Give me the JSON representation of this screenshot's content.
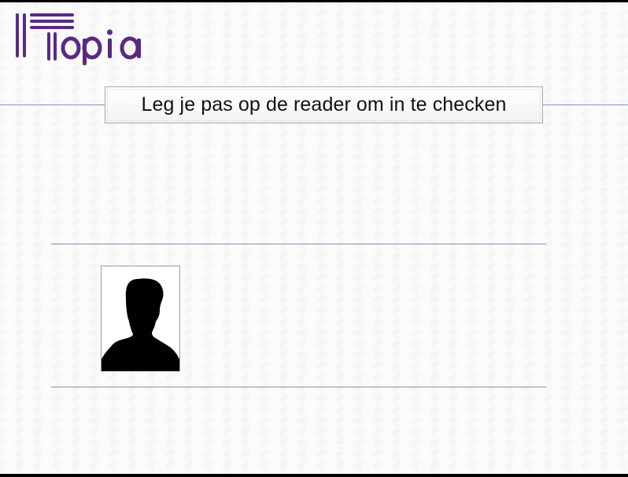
{
  "app": {
    "brand": "Topia"
  },
  "checkin": {
    "instruction": "Leg je pas op de reader om in te checken"
  },
  "member": {
    "photo_icon": "person-silhouette-icon"
  },
  "colors": {
    "brand_purple": "#5a2a82",
    "rule_blue": "#7f96b4",
    "background": "#fbfbfb"
  }
}
